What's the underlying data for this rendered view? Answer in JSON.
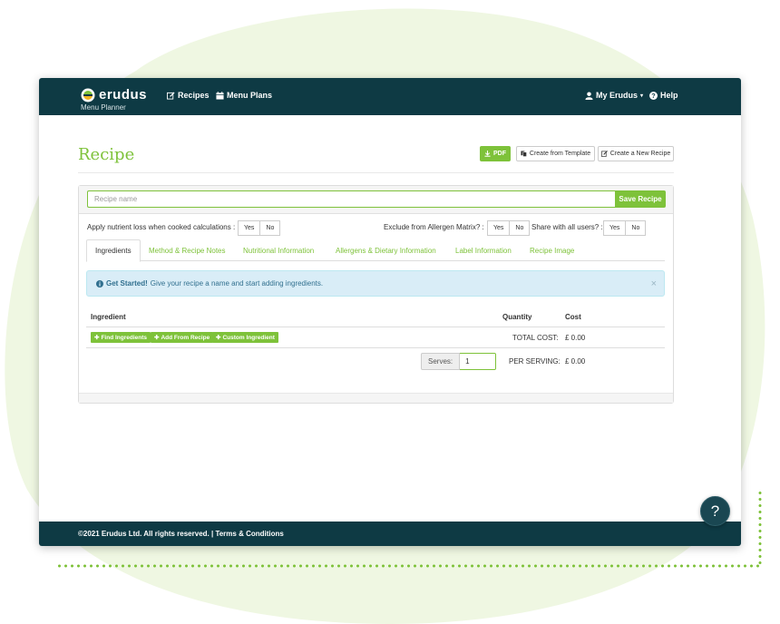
{
  "colors": {
    "accent": "#7ec23a",
    "navbar": "#0e3a44",
    "alert_bg": "#d9edf7"
  },
  "brand": {
    "name": "erudus",
    "subtitle": "Menu Planner"
  },
  "nav": {
    "recipes": "Recipes",
    "menu_plans": "Menu Plans",
    "account": "My Erudus",
    "help": "Help"
  },
  "page": {
    "title": "Recipe",
    "pdf_label": "PDF",
    "template_label": "Create from Template",
    "new_label": "Create a New Recipe"
  },
  "form": {
    "name_placeholder": "Recipe name",
    "save_label": "Save Recipe",
    "nutrient_loss_label": "Apply nutrient loss when cooked calculations :",
    "allergen_label": "Exclude from Allergen Matrix? :",
    "share_label": "Share with all users? :",
    "yes": "Yes",
    "no": "No"
  },
  "tabs": [
    {
      "label": "Ingredients",
      "active": true
    },
    {
      "label": "Method & Recipe Notes"
    },
    {
      "label": "Nutritional Information"
    },
    {
      "label": "Allergens & Dietary Information"
    },
    {
      "label": "Label Information"
    },
    {
      "label": "Recipe Image"
    }
  ],
  "alert": {
    "strong": "Get Started!",
    "text": "Give your recipe a name and start adding ingredients.",
    "close": "×"
  },
  "table": {
    "headers": {
      "ingredient": "Ingredient",
      "quantity": "Quantity",
      "cost": "Cost"
    },
    "buttons": {
      "find": "Find Ingredients",
      "add_recipe": "Add From Recipe",
      "custom": "Custom Ingredient"
    },
    "total_cost_label": "TOTAL COST:",
    "total_cost_value": "£ 0.00",
    "serves_label": "Serves:",
    "serves_value": "1",
    "per_serving_label": "PER SERVING:",
    "per_serving_value": "£ 0.00"
  },
  "footer": {
    "text": "©2021 Erudus Ltd. All rights reserved. | Terms & Conditions"
  },
  "help_fab": "?"
}
